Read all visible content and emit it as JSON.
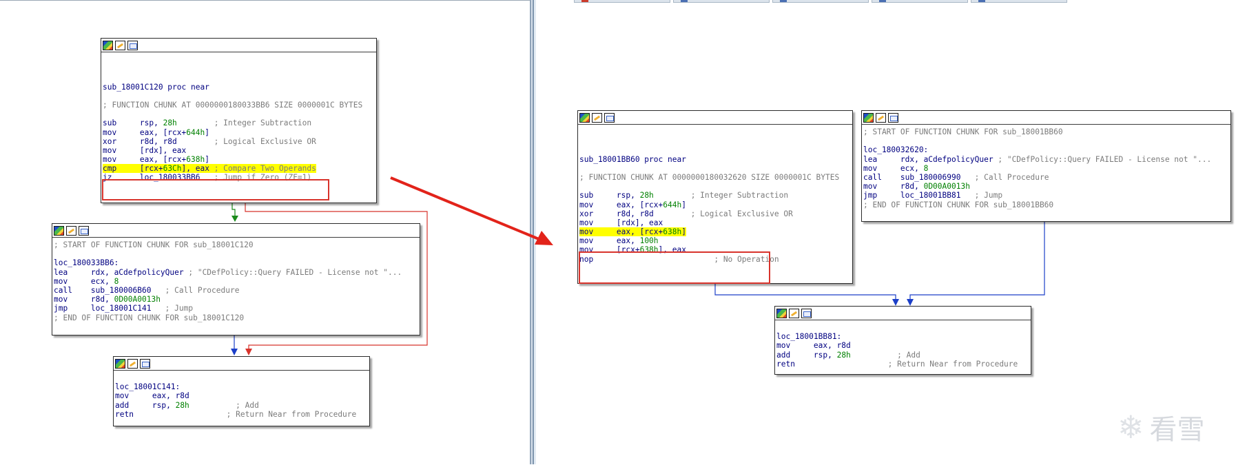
{
  "left_pane": {
    "node1": {
      "lines": [
        {
          "type": "blank"
        },
        {
          "type": "blank"
        },
        {
          "type": "blank"
        },
        {
          "type": "text",
          "text": "sub_18001C120 proc near"
        },
        {
          "type": "blank"
        },
        {
          "type": "comment",
          "text": "; FUNCTION CHUNK AT 0000000180033BB6 SIZE 0000001C BYTES"
        },
        {
          "type": "blank"
        },
        {
          "type": "instr",
          "mn": "sub     ",
          "op": "rsp, ",
          "num": "28h",
          "pad": "        ",
          "cm": "; Integer Subtraction"
        },
        {
          "type": "instr",
          "mn": "mov     ",
          "op": "eax, [rcx+",
          "num": "644h",
          "op2": "]"
        },
        {
          "type": "instr",
          "mn": "xor     ",
          "op": "r8d, r8d",
          "pad": "        ",
          "cm": "; Logical Exclusive OR"
        },
        {
          "type": "instr",
          "mn": "mov     ",
          "op": "[rdx], eax"
        },
        {
          "type": "instr",
          "mn": "mov     ",
          "op": "eax, [rcx+",
          "num": "638h",
          "op2": "]"
        },
        {
          "type": "instr_hl",
          "mn": "cmp     ",
          "op": "[rcx+",
          "num": "63Ch",
          "op2": "], eax",
          "pad": " ",
          "cm": "; Compare Two Operands"
        },
        {
          "type": "instr",
          "mn": "jz      ",
          "op": "loc_180033BB6",
          "pad": "   ",
          "cm": "; Jump if Zero (ZF=1)"
        }
      ]
    },
    "node2": {
      "lines": [
        {
          "type": "comment",
          "text": "; START OF FUNCTION CHUNK FOR sub_18001C120"
        },
        {
          "type": "blank"
        },
        {
          "type": "text",
          "text": "loc_180033BB6:"
        },
        {
          "type": "instr",
          "mn": "lea     ",
          "op": "rdx, aCdefpolicyQuer",
          "pad": " ",
          "cm": "; \"CDefPolicy::Query FAILED - License not \"..."
        },
        {
          "type": "instr",
          "mn": "mov     ",
          "op": "ecx, ",
          "num": "8"
        },
        {
          "type": "instr",
          "mn": "call    ",
          "op": "sub_180006B60",
          "pad": "   ",
          "cm": "; Call Procedure"
        },
        {
          "type": "instr",
          "mn": "mov     ",
          "op": "r8d, ",
          "num": "0D00A0013h"
        },
        {
          "type": "instr",
          "mn": "jmp     ",
          "op": "loc_18001C141",
          "pad": "   ",
          "cm": "; Jump"
        },
        {
          "type": "comment",
          "text": "; END OF FUNCTION CHUNK FOR sub_18001C120"
        }
      ]
    },
    "node3": {
      "lines": [
        {
          "type": "blank"
        },
        {
          "type": "text",
          "text": "loc_18001C141:"
        },
        {
          "type": "instr",
          "mn": "mov     ",
          "op": "eax, r8d"
        },
        {
          "type": "instr",
          "mn": "add     ",
          "op": "rsp, ",
          "num": "28h",
          "pad": "          ",
          "cm": "; Add"
        },
        {
          "type": "instr",
          "mn": "retn",
          "pad": "                    ",
          "cm": "; Return Near from Procedure"
        }
      ]
    }
  },
  "right_pane": {
    "node1": {
      "lines": [
        {
          "type": "blank"
        },
        {
          "type": "blank"
        },
        {
          "type": "blank"
        },
        {
          "type": "text",
          "text": "sub_18001BB60 proc near"
        },
        {
          "type": "blank"
        },
        {
          "type": "comment",
          "text": "; FUNCTION CHUNK AT 0000000180032620 SIZE 0000001C BYTES"
        },
        {
          "type": "blank"
        },
        {
          "type": "instr",
          "mn": "sub     ",
          "op": "rsp, ",
          "num": "28h",
          "pad": "        ",
          "cm": "; Integer Subtraction"
        },
        {
          "type": "instr",
          "mn": "mov     ",
          "op": "eax, [rcx+",
          "num": "644h",
          "op2": "]"
        },
        {
          "type": "instr",
          "mn": "xor     ",
          "op": "r8d, r8d",
          "pad": "        ",
          "cm": "; Logical Exclusive OR"
        },
        {
          "type": "instr",
          "mn": "mov     ",
          "op": "[rdx], eax"
        },
        {
          "type": "instr_hl",
          "mn": "mov     ",
          "op": "eax, [rcx+",
          "num": "638h",
          "op2": "]"
        },
        {
          "type": "instr",
          "mn": "mov     ",
          "op": "eax, ",
          "num": "100h"
        },
        {
          "type": "instr",
          "mn": "mov     ",
          "op": "[rcx+",
          "num": "638h",
          "op2": "], eax"
        },
        {
          "type": "instr",
          "mn": "nop",
          "pad": "                          ",
          "cm": "; No Operation"
        }
      ]
    },
    "node2": {
      "lines": [
        {
          "type": "comment",
          "text": "; START OF FUNCTION CHUNK FOR sub_18001BB60"
        },
        {
          "type": "blank"
        },
        {
          "type": "text",
          "text": "loc_180032620:"
        },
        {
          "type": "instr",
          "mn": "lea     ",
          "op": "rdx, aCdefpolicyQuer",
          "pad": " ",
          "cm": "; \"CDefPolicy::Query FAILED - License not \"..."
        },
        {
          "type": "instr",
          "mn": "mov     ",
          "op": "ecx, ",
          "num": "8"
        },
        {
          "type": "instr",
          "mn": "call    ",
          "op": "sub_180006990",
          "pad": "   ",
          "cm": "; Call Procedure"
        },
        {
          "type": "instr",
          "mn": "mov     ",
          "op": "r8d, ",
          "num": "0D00A0013h"
        },
        {
          "type": "instr",
          "mn": "jmp     ",
          "op": "loc_18001BB81",
          "pad": "   ",
          "cm": "; Jump"
        },
        {
          "type": "comment",
          "text": "; END OF FUNCTION CHUNK FOR sub_18001BB60"
        }
      ]
    },
    "node3": {
      "lines": [
        {
          "type": "blank"
        },
        {
          "type": "text",
          "text": "loc_18001BB81:"
        },
        {
          "type": "instr",
          "mn": "mov     ",
          "op": "eax, r8d"
        },
        {
          "type": "instr",
          "mn": "add     ",
          "op": "rsp, ",
          "num": "28h",
          "pad": "          ",
          "cm": "; Add"
        },
        {
          "type": "instr",
          "mn": "retn",
          "pad": "                    ",
          "cm": "; Return Near from Procedure"
        }
      ]
    }
  },
  "watermark": {
    "text": "看雪"
  },
  "colors": {
    "code": "#000080",
    "comment": "#7b7b7b",
    "number": "#008000",
    "highlight": "#ffff00",
    "annotation": "#d8332b",
    "edge_true": "#1a8a1a",
    "edge_false": "#d8332b",
    "edge_uncond": "#1c3fc8"
  }
}
